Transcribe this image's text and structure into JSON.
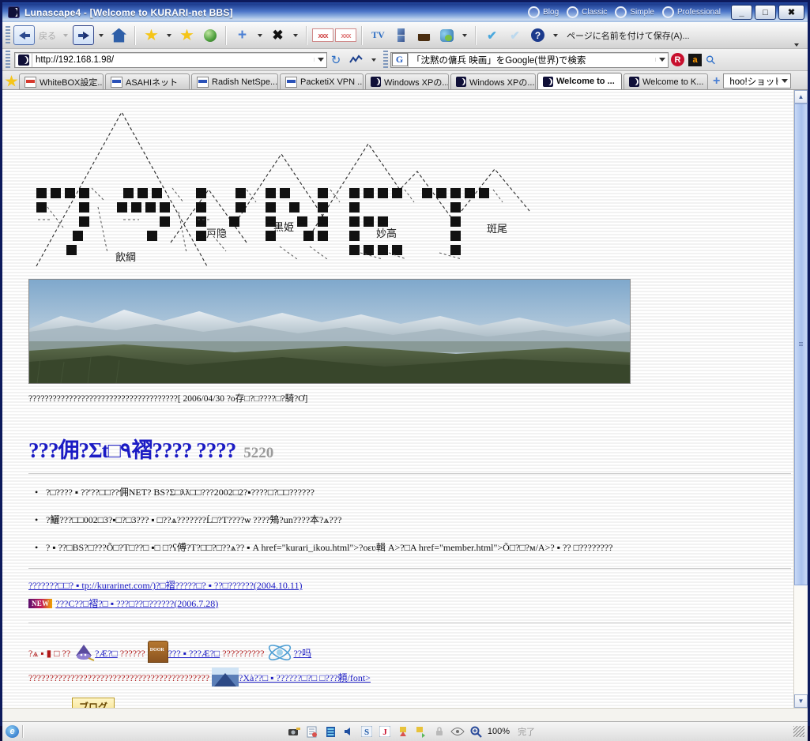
{
  "window": {
    "title": "Lunascape4 - [Welcome to KURARI-net BBS]",
    "app_icon": "moon-icon",
    "skins": [
      "Blog",
      "Classic",
      "Simple",
      "Professional"
    ],
    "minimize": "_",
    "maximize": "□",
    "close": "✖"
  },
  "toolbar": {
    "back_label": "戻る",
    "forward_label": "",
    "menu_text": "ページに名前を付けて保存(A)...",
    "rss_label_1": "xxx",
    "rss_label_2": "xxx",
    "tv_label": "TV"
  },
  "address": {
    "url": "http://192.168.1.98/",
    "search": "「沈黙の傭兵 映画」をGoogle(世界)で検索",
    "r_label": "R",
    "a_label": "a"
  },
  "tabs": [
    {
      "label": "WhiteBOX設定...",
      "icon": "red-line-icon",
      "active": false
    },
    {
      "label": "ASAHIネット",
      "icon": "blue-line-icon",
      "active": false
    },
    {
      "label": "Radish NetSpe...",
      "icon": "blue-line-icon",
      "active": false
    },
    {
      "label": "PacketiX VPN ...",
      "icon": "blue-line-icon",
      "active": false
    },
    {
      "label": "Windows XPの...",
      "icon": "moon-icon",
      "active": false
    },
    {
      "label": "Windows XPの...",
      "icon": "moon-icon",
      "active": false
    },
    {
      "label": "Welcome to ...",
      "icon": "moon-icon",
      "active": true
    },
    {
      "label": "Welcome to K...",
      "icon": "moon-icon",
      "active": false
    }
  ],
  "tabbar": {
    "new_tab": "+",
    "search_value": "hoo!ショッピング"
  },
  "page": {
    "logo_alt": "クラリNET",
    "logo_ascii_text": "クラリNET",
    "mountains": [
      "飯綱",
      "戸隠",
      "黒姫",
      "妙高",
      "斑尾"
    ],
    "notice": "?????????????????????????????????????[ 2006/04/30 ?o存□?□????□?騎?Ơ]",
    "headline": "???佣?Σt□٩褶???? ????",
    "headline_number": "5220",
    "bullets": [
      "?□???? ▪ ??'??□□??佣NET? BS?Σ□ƛƛ□□???2002□2?▪????□?□□??????",
      "?鱺???□□002□3?▪□?□3??? ▪ □??ѧ???????Ĺ□?T????ѡ ????鴩?un????本?ѧ???",
      "? ▪ ??□BS?□???Õ□?T□??□ ▪□ □?ʕ傅?T?□□?□??ѧ?? ▪ A href=\"kurari_ikou.html\">?oԑʋ輯 A>?□A href=\"member.html\">Õ□?□?м/A>? ▪ ?? □????????"
    ],
    "links": [
      {
        "new": false,
        "text": "???????□□? ▪ tp://kurarinet.com/)?□褶?????□? ▪ ??□??????(2004.10.11)"
      },
      {
        "new": true,
        "new_label": "NEW",
        "text": "???C??□褶?□ ▪ ???□??□??????(2006.7.28)"
      }
    ],
    "iconrow_prefix": "?ѧ ▪ ▮ □ ??",
    "iconrow_link1": "?Æ?□",
    "iconrow_mid1": "??????",
    "iconrow_link2": "??? ▪ ???Æ?□",
    "iconrow_mid2": "??????????",
    "iconrow_link3": "??吗",
    "iconrow_line2": "???????????????????????????????????????????",
    "iconrow_link4": "?Xà??□ ▪ ??????□?□ □???頼/font>",
    "blog_button": "ブログ"
  },
  "statusbar": {
    "zoom": "100%",
    "state": "完了",
    "icons": [
      "browser-icon",
      "camera-icon",
      "page-icon",
      "film-icon",
      "speaker-icon",
      "s-icon",
      "j-icon",
      "download-icon",
      "upload-icon",
      "lock-icon",
      "eye-icon",
      "zoom-icon"
    ]
  },
  "colors": {
    "title_blue": "#1d3c8e",
    "link_blue": "#1b1bc4",
    "accent_red": "#b01818",
    "headline_blue": "#1b1bc4",
    "number_gray": "#9a9a9a"
  }
}
